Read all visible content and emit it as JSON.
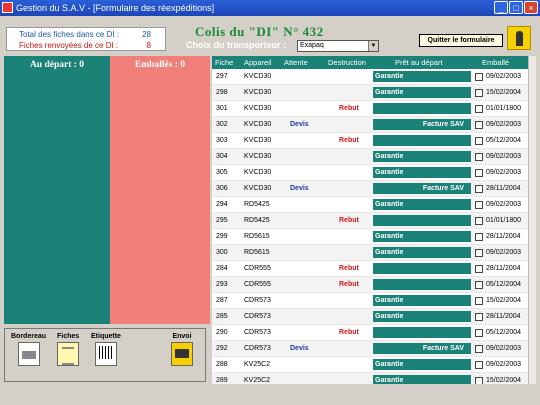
{
  "window": {
    "title": "Gestion du S.A.V - [Formulaire des réexpéditions]"
  },
  "counters": {
    "total_label": "Total des fiches dans ce DI :",
    "total_value": "28",
    "returned_label": "Fiches renvoyées de ce DI :",
    "returned_value": "8"
  },
  "header": {
    "title": "Colis du \"DI\" N° 432",
    "carrier_label": "Choix du transporteur :",
    "carrier_value": "Exapaq",
    "quit_label": "Quitter le formulaire"
  },
  "panels": {
    "depart_label": "Au départ : 0",
    "emballes_label": "Emballés : 0"
  },
  "grid": {
    "headers": [
      "Fiche",
      "Appareil",
      "Attente",
      "Destruction",
      "Prêt au départ",
      "Emballé"
    ],
    "rows": [
      {
        "fiche": "297",
        "appareil": "KVCD30",
        "attente": "",
        "destruction": "",
        "pret": "Garantie",
        "date": "09/02/2003"
      },
      {
        "fiche": "298",
        "appareil": "KVCD30",
        "attente": "",
        "destruction": "",
        "pret": "Garantie",
        "date": "15/02/2004"
      },
      {
        "fiche": "301",
        "appareil": "KVCD30",
        "attente": "",
        "destruction": "Rebut",
        "pret": "",
        "date": "01/01/1800"
      },
      {
        "fiche": "302",
        "appareil": "KVCD30",
        "attente": "Devis",
        "destruction": "",
        "pret": "Facture SAV",
        "date": "09/02/2003"
      },
      {
        "fiche": "303",
        "appareil": "KVCD30",
        "attente": "",
        "destruction": "Rebut",
        "pret": "",
        "date": "05/12/2004"
      },
      {
        "fiche": "304",
        "appareil": "KVCD30",
        "attente": "",
        "destruction": "",
        "pret": "Garantie",
        "date": "09/02/2003"
      },
      {
        "fiche": "305",
        "appareil": "KVCD30",
        "attente": "",
        "destruction": "",
        "pret": "Garantie",
        "date": "09/02/2003"
      },
      {
        "fiche": "306",
        "appareil": "KVCD30",
        "attente": "Devis",
        "destruction": "",
        "pret": "Facture SAV",
        "date": "28/11/2004"
      },
      {
        "fiche": "294",
        "appareil": "RD5425",
        "attente": "",
        "destruction": "",
        "pret": "Garantie",
        "date": "09/02/2003"
      },
      {
        "fiche": "295",
        "appareil": "RD5425",
        "attente": "",
        "destruction": "Rebut",
        "pret": "",
        "date": "01/01/1800"
      },
      {
        "fiche": "299",
        "appareil": "RD5615",
        "attente": "",
        "destruction": "",
        "pret": "Garantie",
        "date": "28/11/2004"
      },
      {
        "fiche": "300",
        "appareil": "RD5615",
        "attente": "",
        "destruction": "",
        "pret": "Garantie",
        "date": "09/02/2003"
      },
      {
        "fiche": "284",
        "appareil": "CDR555",
        "attente": "",
        "destruction": "Rebut",
        "pret": "",
        "date": "28/11/2004"
      },
      {
        "fiche": "293",
        "appareil": "CDR555",
        "attente": "",
        "destruction": "Rebut",
        "pret": "",
        "date": "05/12/2004"
      },
      {
        "fiche": "287",
        "appareil": "CDR573",
        "attente": "",
        "destruction": "",
        "pret": "Garantie",
        "date": "15/02/2004"
      },
      {
        "fiche": "285",
        "appareil": "CDR573",
        "attente": "",
        "destruction": "",
        "pret": "Garantie",
        "date": "28/11/2004"
      },
      {
        "fiche": "290",
        "appareil": "CDR573",
        "attente": "",
        "destruction": "Rebut",
        "pret": "",
        "date": "05/12/2004"
      },
      {
        "fiche": "292",
        "appareil": "CDR573",
        "attente": "Devis",
        "destruction": "",
        "pret": "Facture SAV",
        "date": "09/02/2003"
      },
      {
        "fiche": "288",
        "appareil": "KV25C2",
        "attente": "",
        "destruction": "",
        "pret": "Garantie",
        "date": "09/02/2003"
      },
      {
        "fiche": "289",
        "appareil": "KV25C2",
        "attente": "",
        "destruction": "",
        "pret": "Garantie",
        "date": "15/02/2004"
      }
    ]
  },
  "toolbar": {
    "bordereau": "Bordereau",
    "fiches": "Fiches",
    "etiquette": "Etiquette",
    "envoi": "Envoi"
  }
}
